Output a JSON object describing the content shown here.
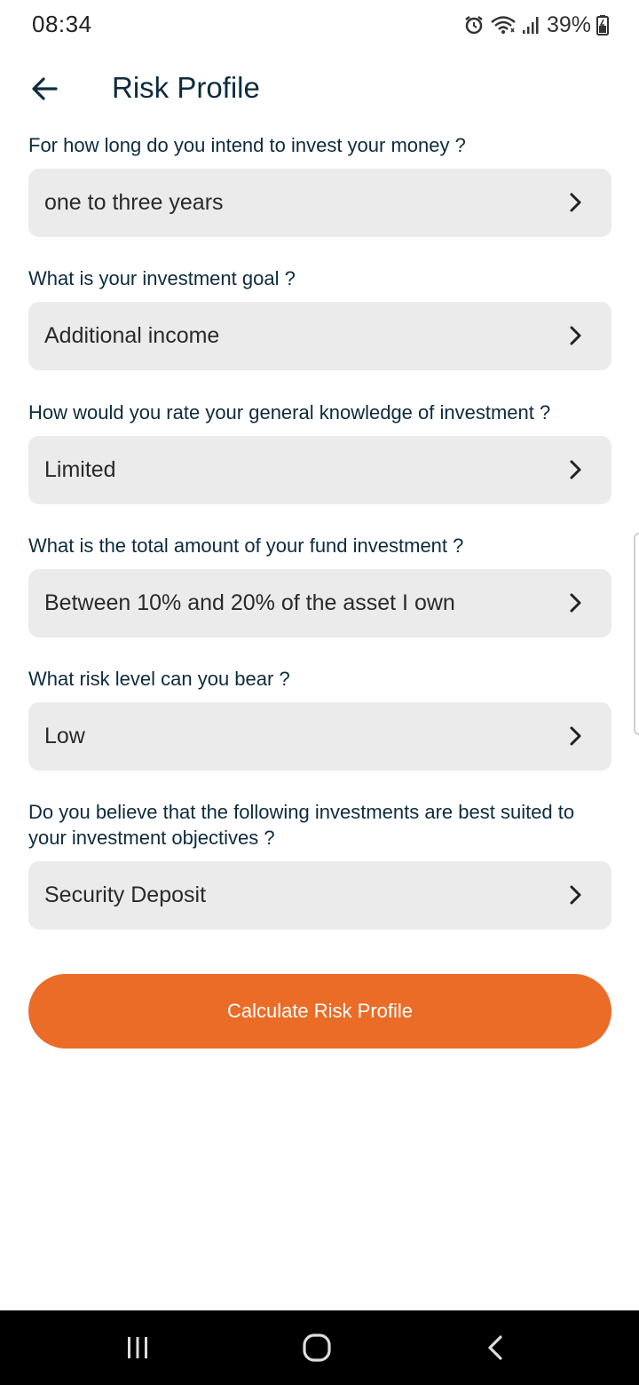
{
  "status": {
    "time": "08:34",
    "battery": "39%",
    "icons": [
      "alarm-icon",
      "wifi-icon",
      "signal-icon",
      "battery-icon"
    ]
  },
  "header": {
    "title": "Risk Profile",
    "back_icon": "arrow-left-icon"
  },
  "form": {
    "questions": [
      {
        "label": "For how long do you intend to invest your money ?",
        "value": "one to three years"
      },
      {
        "label": "What is your investment goal ?",
        "value": "Additional income"
      },
      {
        "label": "How would you rate your general knowledge of investment ?",
        "value": "Limited"
      },
      {
        "label": "What is the total amount of your fund investment ?",
        "value": "Between 10% and 20% of the asset I own"
      },
      {
        "label": "What risk level can you bear ?",
        "value": "Low"
      },
      {
        "label": "Do you believe that the following investments are best suited to your investment objectives ?",
        "value": "Security Deposit"
      }
    ]
  },
  "actions": {
    "calculate_label": "Calculate Risk Profile"
  },
  "colors": {
    "accent": "#ea6c27",
    "text_primary": "#0d2b3e",
    "field_bg": "#ebebeb"
  },
  "nav": {
    "recents_icon": "recent-apps-icon",
    "home_icon": "home-icon",
    "back_icon": "back-chevron-icon"
  }
}
